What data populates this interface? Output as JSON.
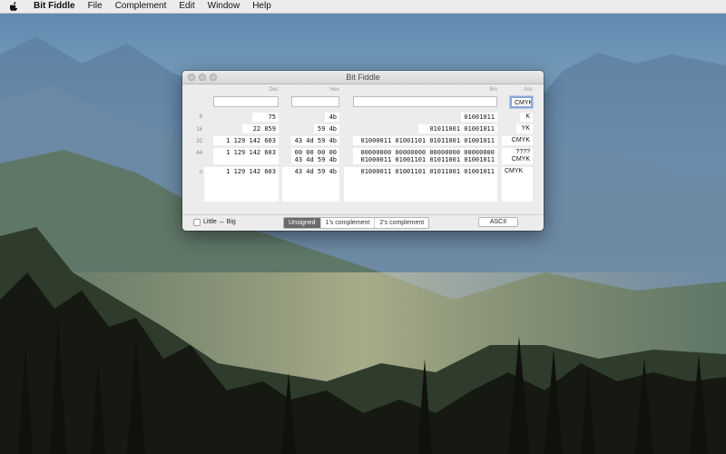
{
  "menubar": {
    "apple_icon": "apple-logo-icon",
    "app_name": "Bit Fiddle",
    "items": [
      "File",
      "Complement",
      "Edit",
      "Window",
      "Help"
    ]
  },
  "window": {
    "title": "Bit Fiddle",
    "columns": {
      "dec": "Dec",
      "hex": "Hex",
      "bin": "Bin",
      "asc": "Asc"
    },
    "inputs": {
      "dec": "",
      "hex": "",
      "bin": "",
      "asc": "CMYK"
    },
    "rows": [
      {
        "label": "8",
        "dec": "75",
        "hex": "4b",
        "bin": "01001011",
        "asc": "K"
      },
      {
        "label": "16",
        "dec": "22 859",
        "hex": "59 4b",
        "bin": "01011001 01001011",
        "asc": "YK"
      },
      {
        "label": "32",
        "dec": "1 129 142 603",
        "hex": "43 4d 59 4b",
        "bin": "01000011 01001101 01011001 01001011",
        "asc": "CMYK"
      },
      {
        "label": "64",
        "dec": "1 129 142 603",
        "hex": "00 00 00 00\n43 4d 59 4b",
        "bin": "00000000 00000000 00000000 00000000\n01000011 01001101 01011001 01001011",
        "asc": "????\nCMYK"
      },
      {
        "label": "n",
        "dec": "1 129 142 603",
        "hex": "43 4d 59 4b",
        "bin": "01000011 01001101 01011001 01001011",
        "asc": "CMYK"
      }
    ],
    "footer": {
      "endian_label": "Little ↔ Big",
      "modes": [
        "Unsigned",
        "1's complement",
        "2's complement"
      ],
      "active_mode": "Unsigned",
      "ascii_button": "ASCII"
    }
  }
}
